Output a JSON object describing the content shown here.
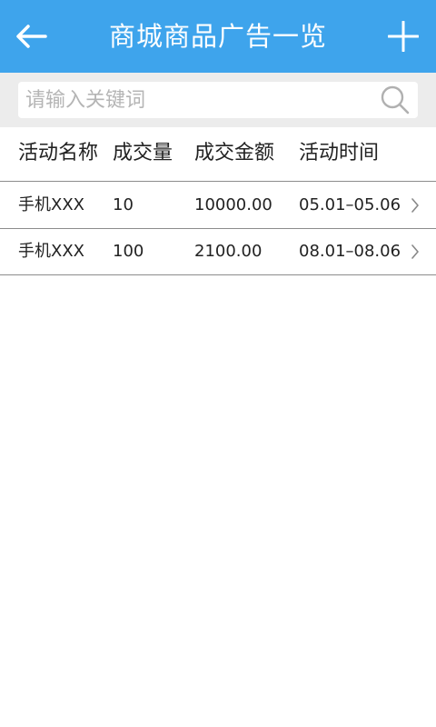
{
  "header": {
    "back_icon": "arrow-left-icon",
    "title": "商城商品广告一览",
    "add_icon": "plus-icon",
    "background_color": "#3ea4ec"
  },
  "search": {
    "placeholder": "请输入关键词",
    "value": "",
    "icon": "search-icon"
  },
  "table": {
    "columns": [
      "活动名称",
      "成交量",
      "成交金额",
      "活动时间"
    ],
    "rows": [
      {
        "name": "手机XXX",
        "volume": "10",
        "amount": "10000.00",
        "period": "05.01–05.06"
      },
      {
        "name": "手机XXX",
        "volume": "100",
        "amount": "2100.00",
        "period": "08.01–08.06"
      }
    ],
    "row_icon": "chevron-right-icon"
  }
}
